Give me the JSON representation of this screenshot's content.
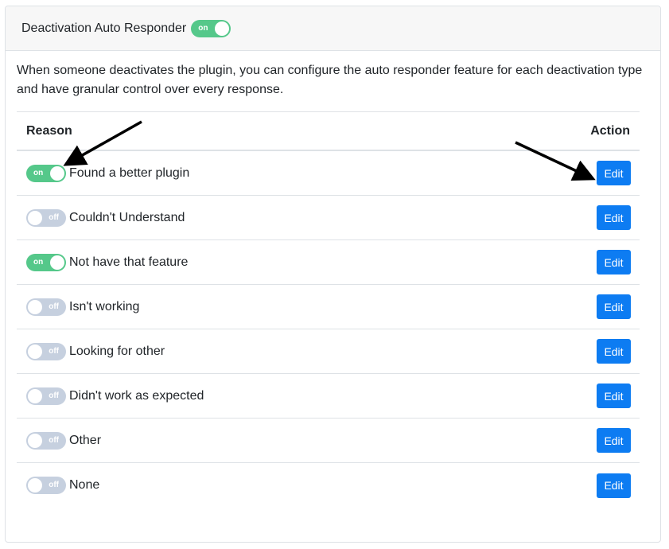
{
  "header": {
    "title": "Deactivation Auto Responder",
    "toggle": {
      "state": "on",
      "label": "on"
    }
  },
  "description": "When someone deactivates the plugin, you can configure the auto responder feature for each deactivation type and have granular control over every response.",
  "table": {
    "columns": {
      "reason": "Reason",
      "action": "Action"
    },
    "rows": [
      {
        "reason": "Found a better plugin",
        "toggle": "on",
        "toggle_label": "on",
        "action": "Edit"
      },
      {
        "reason": "Couldn't Understand",
        "toggle": "off",
        "toggle_label": "off",
        "action": "Edit"
      },
      {
        "reason": "Not have that feature",
        "toggle": "on",
        "toggle_label": "on",
        "action": "Edit"
      },
      {
        "reason": "Isn't working",
        "toggle": "off",
        "toggle_label": "off",
        "action": "Edit"
      },
      {
        "reason": "Looking for other",
        "toggle": "off",
        "toggle_label": "off",
        "action": "Edit"
      },
      {
        "reason": "Didn't work as expected",
        "toggle": "off",
        "toggle_label": "off",
        "action": "Edit"
      },
      {
        "reason": "Other",
        "toggle": "off",
        "toggle_label": "off",
        "action": "Edit"
      },
      {
        "reason": "None",
        "toggle": "off",
        "toggle_label": "off",
        "action": "Edit"
      }
    ]
  },
  "colors": {
    "toggle_on": "#55c88a",
    "toggle_off": "#c6d0df",
    "button": "#0d7cf2",
    "header_bg": "#f7f7f7",
    "border": "#dee2e6"
  }
}
